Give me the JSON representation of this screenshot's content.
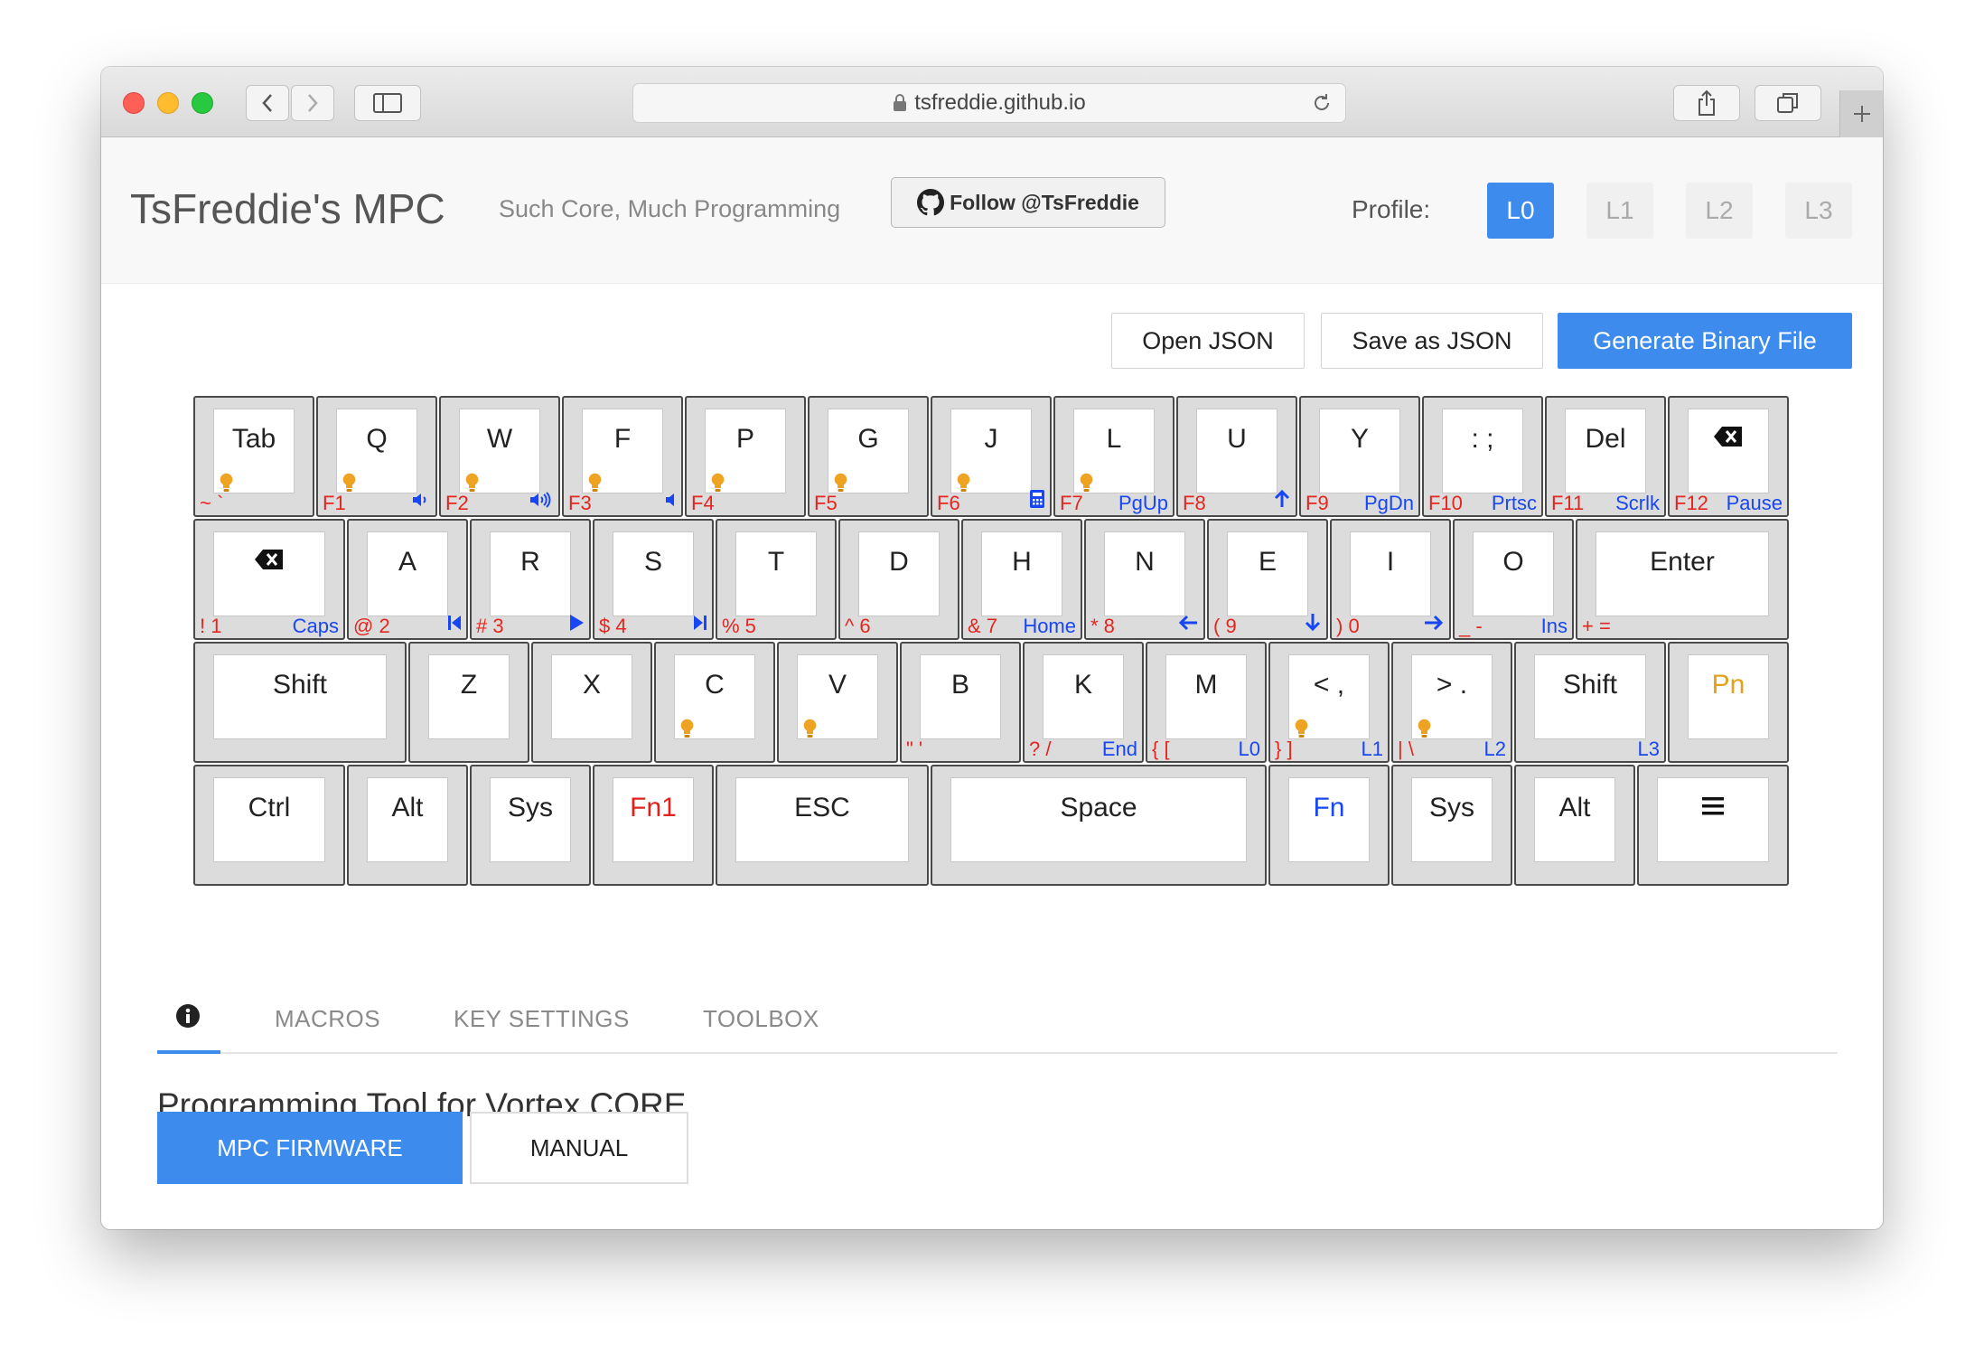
{
  "browser": {
    "url": "tsfreddie.github.io"
  },
  "header": {
    "brand": "TsFreddie's MPC",
    "tagline": "Such Core, Much Programming",
    "follow": "Follow @TsFreddie",
    "profile_label": "Profile:",
    "profiles": [
      "L0",
      "L1",
      "L2",
      "L3"
    ],
    "active_profile": "L0"
  },
  "actions": {
    "open": "Open JSON",
    "save": "Save as JSON",
    "generate": "Generate Binary File"
  },
  "keyboard": {
    "rows": [
      [
        {
          "label": "Tab",
          "bulb": true,
          "left": "~ `",
          "right": ""
        },
        {
          "label": "Q",
          "bulb": true,
          "left": "F1",
          "right": "",
          "right_icon": "volume-mute-icon"
        },
        {
          "label": "W",
          "bulb": true,
          "left": "F2",
          "right": "",
          "right_icon": "volume-up-icon"
        },
        {
          "label": "F",
          "bulb": true,
          "left": "F3",
          "right": "",
          "right_icon": "volume-down-icon"
        },
        {
          "label": "P",
          "bulb": true,
          "left": "F4",
          "right": ""
        },
        {
          "label": "G",
          "bulb": true,
          "left": "F5",
          "right": ""
        },
        {
          "label": "J",
          "bulb": true,
          "left": "F6",
          "right": "",
          "right_icon": "calculator-icon"
        },
        {
          "label": "L",
          "bulb": true,
          "left": "F7",
          "right": "PgUp"
        },
        {
          "label": "U",
          "bulb": false,
          "left": "F8",
          "right": "",
          "right_icon": "arrow-up-icon"
        },
        {
          "label": "Y",
          "bulb": false,
          "left": "F9",
          "right": "PgDn"
        },
        {
          "label": ": ;",
          "bulb": false,
          "left": "F10",
          "right": "Prtsc"
        },
        {
          "label": "Del",
          "bulb": false,
          "left": "F11",
          "right": "Scrlk"
        },
        {
          "label": "",
          "icon": "backspace-icon",
          "bulb": false,
          "left": "F12",
          "right": "Pause"
        }
      ],
      [
        {
          "label": "",
          "icon": "backspace-icon",
          "bulb": false,
          "left": "! 1",
          "right": "Caps"
        },
        {
          "label": "A",
          "bulb": false,
          "left": "@ 2",
          "right": "",
          "right_icon": "prev-track-icon"
        },
        {
          "label": "R",
          "bulb": false,
          "left": "# 3",
          "right": "",
          "right_icon": "play-icon"
        },
        {
          "label": "S",
          "bulb": false,
          "left": "$ 4",
          "right": "",
          "right_icon": "next-track-icon"
        },
        {
          "label": "T",
          "bulb": false,
          "left": "% 5",
          "right": ""
        },
        {
          "label": "D",
          "bulb": false,
          "left": "^ 6",
          "right": ""
        },
        {
          "label": "H",
          "bulb": false,
          "left": "& 7",
          "right": "Home"
        },
        {
          "label": "N",
          "bulb": false,
          "left": "* 8",
          "right": "",
          "right_icon": "arrow-left-icon"
        },
        {
          "label": "E",
          "bulb": false,
          "left": "( 9",
          "right": "",
          "right_icon": "arrow-down-icon"
        },
        {
          "label": "I",
          "bulb": false,
          "left": ") 0",
          "right": "",
          "right_icon": "arrow-right-icon"
        },
        {
          "label": "O",
          "bulb": false,
          "left": "_ -",
          "right": "Ins"
        },
        {
          "label": "Enter",
          "bulb": false,
          "left": "+ =",
          "right": ""
        }
      ],
      [
        {
          "label": "Shift",
          "bulb": false,
          "left": "",
          "right": ""
        },
        {
          "label": "Z",
          "bulb": false,
          "left": "",
          "right": ""
        },
        {
          "label": "X",
          "bulb": false,
          "left": "",
          "right": ""
        },
        {
          "label": "C",
          "bulb": true,
          "left": "",
          "right": ""
        },
        {
          "label": "V",
          "bulb": true,
          "left": "",
          "right": ""
        },
        {
          "label": "B",
          "bulb": false,
          "left": "\" '",
          "right": ""
        },
        {
          "label": "K",
          "bulb": false,
          "left": "? /",
          "right": "End"
        },
        {
          "label": "M",
          "bulb": false,
          "left": "{ [",
          "right": "L0"
        },
        {
          "label": "< ,",
          "bulb": true,
          "left": "} ]",
          "right": "L1"
        },
        {
          "label": "> .",
          "bulb": true,
          "left": "| \\",
          "right": "L2"
        },
        {
          "label": "Shift",
          "bulb": false,
          "left": "",
          "right": "L3"
        },
        {
          "label": "Pn",
          "color": "orange",
          "bulb": false,
          "left": "",
          "right": ""
        }
      ],
      [
        {
          "label": "Ctrl",
          "bulb": false,
          "left": "",
          "right": ""
        },
        {
          "label": "Alt",
          "bulb": false,
          "left": "",
          "right": ""
        },
        {
          "label": "Sys",
          "bulb": false,
          "left": "",
          "right": ""
        },
        {
          "label": "Fn1",
          "color": "red",
          "bulb": false,
          "left": "",
          "right": ""
        },
        {
          "label": "ESC",
          "bulb": false,
          "left": "",
          "right": ""
        },
        {
          "label": "Space",
          "bulb": false,
          "left": "",
          "right": ""
        },
        {
          "label": "Fn",
          "color": "blue",
          "bulb": false,
          "left": "",
          "right": ""
        },
        {
          "label": "Sys",
          "bulb": false,
          "left": "",
          "right": ""
        },
        {
          "label": "Alt",
          "bulb": false,
          "left": "",
          "right": ""
        },
        {
          "label": "",
          "icon": "menu-icon",
          "bulb": false,
          "left": "",
          "right": ""
        }
      ]
    ]
  },
  "tabs": {
    "info_icon": "info-icon",
    "items": [
      "MACROS",
      "KEY SETTINGS",
      "TOOLBOX"
    ]
  },
  "content": {
    "title": "Programming Tool for Vortex CORE",
    "firmware": "MPC FIRMWARE",
    "manual": "MANUAL"
  }
}
